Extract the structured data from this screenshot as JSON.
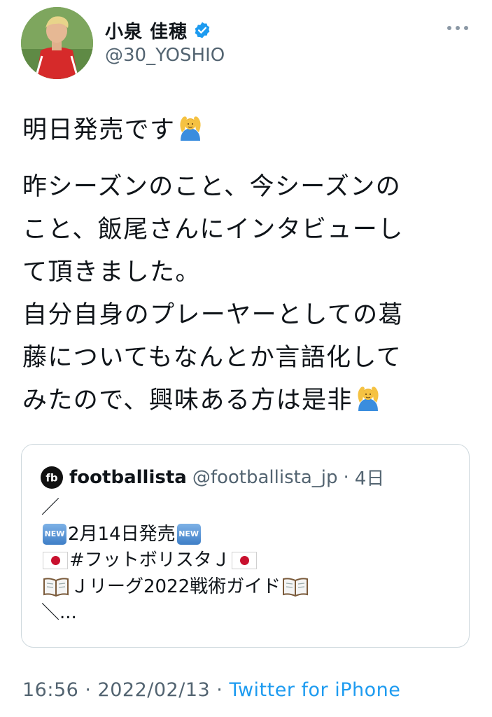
{
  "author": {
    "display_name": "小泉 佳穂",
    "handle": "@30_YOSHIO",
    "verified_icon": "verified-badge-icon",
    "more_icon": "more-options-icon"
  },
  "tweet": {
    "line1": "明日発売です",
    "line2": "昨シーズンのこと、今シーズンの",
    "line3": "こと、飯尾さんにインタビューし",
    "line4": "て頂きました。",
    "line5": "自分自身のプレーヤーとしての葛",
    "line6": "藤についてもなんとか言語化して",
    "line7": "みたので、興味ある方は是非",
    "emoji": "person-gesturing-ok-icon"
  },
  "quote": {
    "name": "footballista",
    "handle": "@footballista_jp",
    "sep": "·",
    "time": "4日",
    "line1": "／",
    "line2": "2月14日発売",
    "line3": "#フットボリスタＪ",
    "line4": "Ｊリーグ2022戦術ガイド",
    "line5": "＼...",
    "new_badge": "NEW"
  },
  "footer": {
    "time": "16:56 · 2022/02/13 · ",
    "source": "Twitter for iPhone"
  },
  "colors": {
    "text": "#0f1419",
    "secondary": "#536471",
    "link": "#1d9bf0",
    "verified": "#1d9bf0",
    "border": "#cfd9de"
  }
}
